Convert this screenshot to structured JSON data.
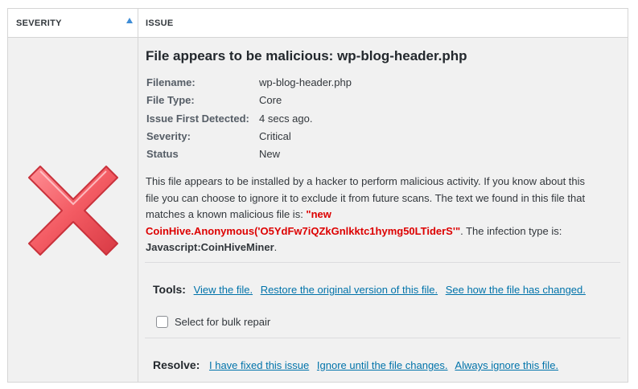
{
  "header": {
    "severity_label": "SEVERITY",
    "issue_label": "ISSUE"
  },
  "issue": {
    "severity_icon": "critical-x-icon",
    "title": "File appears to be malicious: wp-blog-header.php",
    "details": [
      {
        "label": "Filename:",
        "value": "wp-blog-header.php"
      },
      {
        "label": "File Type:",
        "value": "Core"
      },
      {
        "label": "Issue First Detected:",
        "value": "4 secs ago."
      },
      {
        "label": "Severity:",
        "value": "Critical"
      },
      {
        "label": "Status",
        "value": "New"
      }
    ],
    "description": {
      "intro": "This file appears to be installed by a hacker to perform malicious activity. If you know about this file you can choose to ignore it to exclude it from future scans. The text we found in this file that matches a known malicious file is: ",
      "match": "\"new CoinHive.Anonymous('O5YdFw7iQZkGnlkktc1hymg50LTiderS'\"",
      "mid": ". The infection type is: ",
      "infection_type": "Javascript:CoinHiveMiner",
      "end": "."
    },
    "tools": {
      "label": "Tools:",
      "links": [
        "View the file.",
        "Restore the original version of this file.",
        "See how the file has changed."
      ]
    },
    "bulk_repair": {
      "label": "Select for bulk repair",
      "checked": false
    },
    "resolve": {
      "label": "Resolve:",
      "links": [
        "I have fixed this issue",
        "Ignore until the file changes.",
        "Always ignore this file."
      ]
    }
  },
  "colors": {
    "link": "#0073aa",
    "malicious_text": "#dd0000",
    "sort_arrow": "#3f8dd6",
    "severity_icon": "#f35b63"
  }
}
